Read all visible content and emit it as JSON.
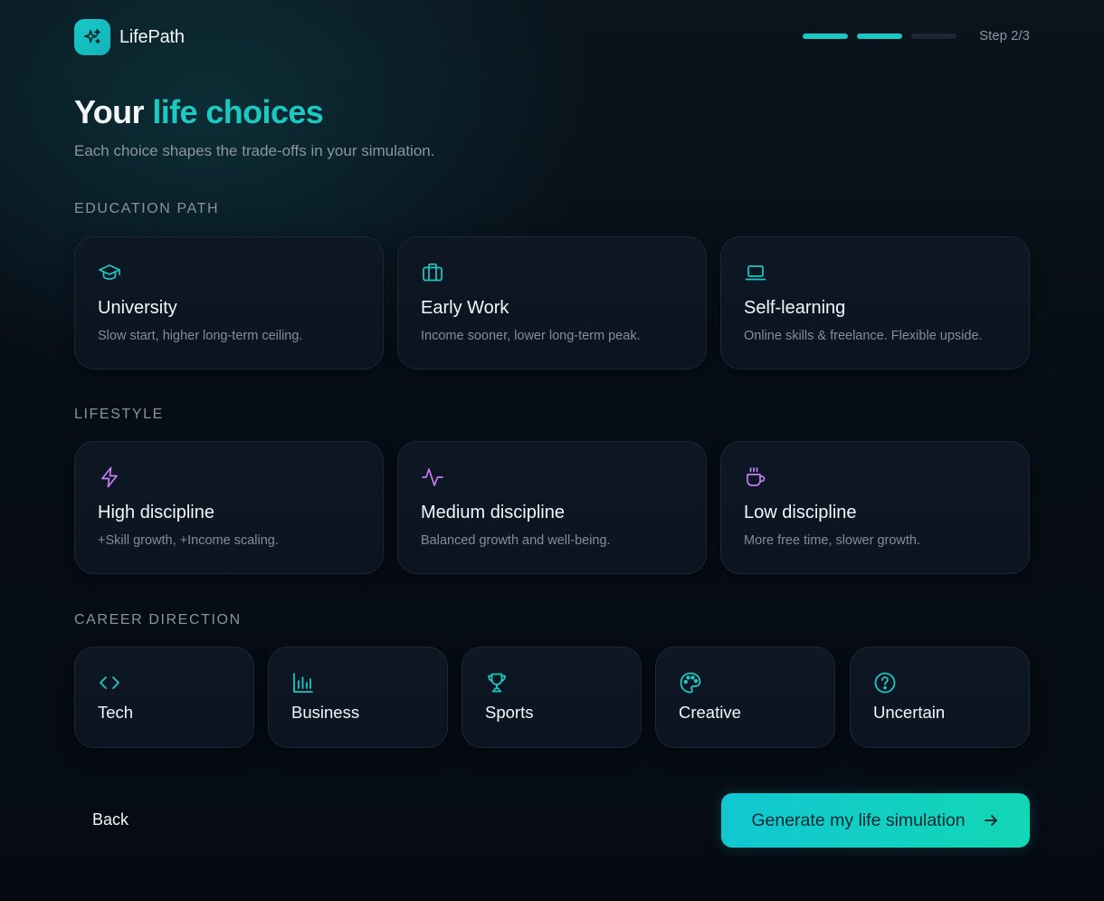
{
  "app": {
    "name": "LifePath",
    "logo_icon": "sparkles-icon"
  },
  "progress": {
    "total_steps": 3,
    "current_step": 2,
    "label": "Step 2/3"
  },
  "heading": {
    "title_plain": "Your ",
    "title_accent": "life choices",
    "subtitle": "Each choice shapes the trade-offs in your simulation."
  },
  "colors": {
    "accent": "#1cc9c2",
    "lifestyle_icon": "#c67df2",
    "background": "#070d16"
  },
  "education": {
    "label": "EDUCATION PATH",
    "options": [
      {
        "icon": "graduation-cap-icon",
        "name": "University",
        "desc": "Slow start, higher long-term ceiling."
      },
      {
        "icon": "briefcase-icon",
        "name": "Early Work",
        "desc": "Income sooner, lower long-term peak."
      },
      {
        "icon": "laptop-icon",
        "name": "Self-learning",
        "desc": "Online skills & freelance. Flexible upside."
      }
    ]
  },
  "lifestyle": {
    "label": "LIFESTYLE",
    "options": [
      {
        "icon": "lightning-icon",
        "name": "High discipline",
        "desc": "+Skill growth, +Income scaling."
      },
      {
        "icon": "activity-icon",
        "name": "Medium discipline",
        "desc": "Balanced growth and well-being."
      },
      {
        "icon": "coffee-icon",
        "name": "Low discipline",
        "desc": "More free time, slower growth."
      }
    ]
  },
  "career": {
    "label": "CAREER DIRECTION",
    "options": [
      {
        "icon": "code-icon",
        "name": "Tech"
      },
      {
        "icon": "bar-chart-icon",
        "name": "Business"
      },
      {
        "icon": "trophy-icon",
        "name": "Sports"
      },
      {
        "icon": "palette-icon",
        "name": "Creative"
      },
      {
        "icon": "help-circle-icon",
        "name": "Uncertain"
      }
    ]
  },
  "footer": {
    "back_label": "Back",
    "generate_label": "Generate my life simulation"
  }
}
